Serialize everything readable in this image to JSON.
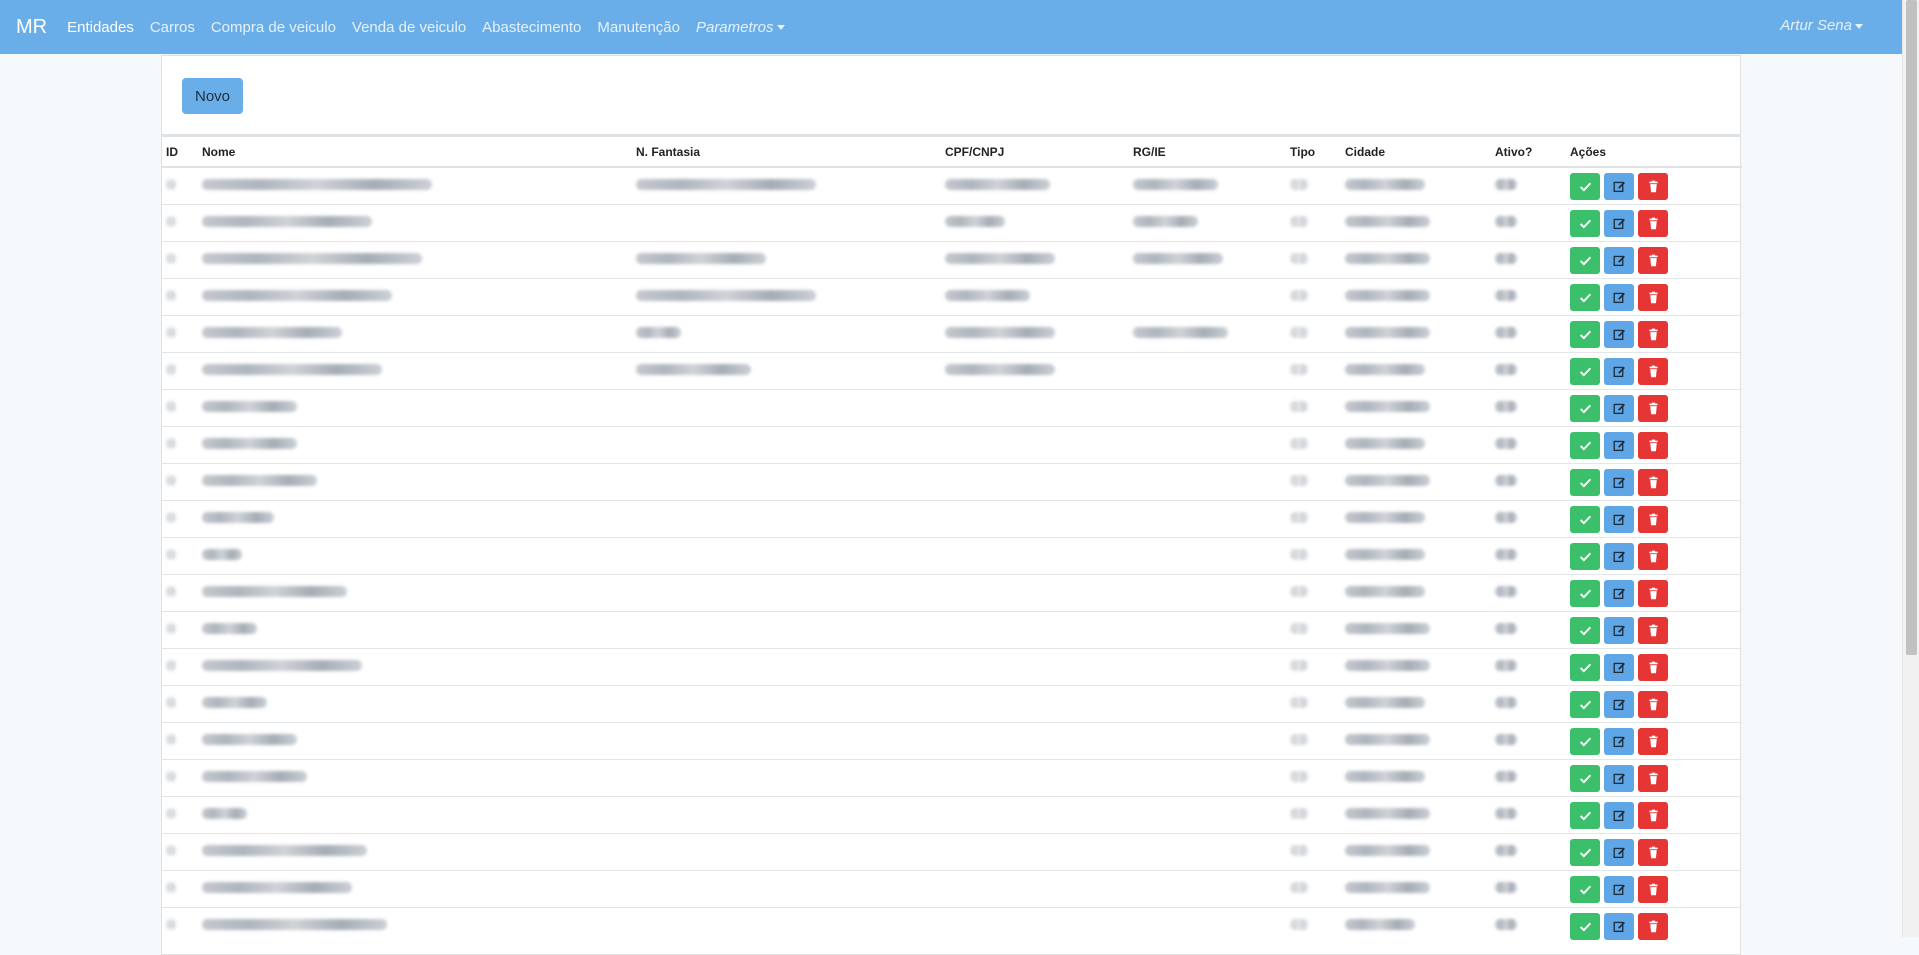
{
  "navbar": {
    "brand": "MR",
    "items": [
      {
        "label": "Entidades"
      },
      {
        "label": "Carros"
      },
      {
        "label": "Compra de veiculo"
      },
      {
        "label": "Venda de veiculo"
      },
      {
        "label": "Abastecimento"
      },
      {
        "label": "Manutenção"
      },
      {
        "label": "Parametros"
      }
    ],
    "user": "Artur Sena"
  },
  "toolbar": {
    "new_label": "Novo"
  },
  "table": {
    "columns": [
      "ID",
      "Nome",
      "N. Fantasia",
      "CPF/CNPJ",
      "RG/IE",
      "Tipo",
      "Cidade",
      "Ativo?",
      "Ações"
    ],
    "row_count": 21
  },
  "icons": {
    "ok": "check-icon",
    "edit": "edit-icon",
    "delete": "trash-icon"
  },
  "colors": {
    "navbar": "#6aaee9",
    "ok": "#3bbf6b",
    "edit": "#5fa6e6",
    "delete": "#e53535"
  }
}
